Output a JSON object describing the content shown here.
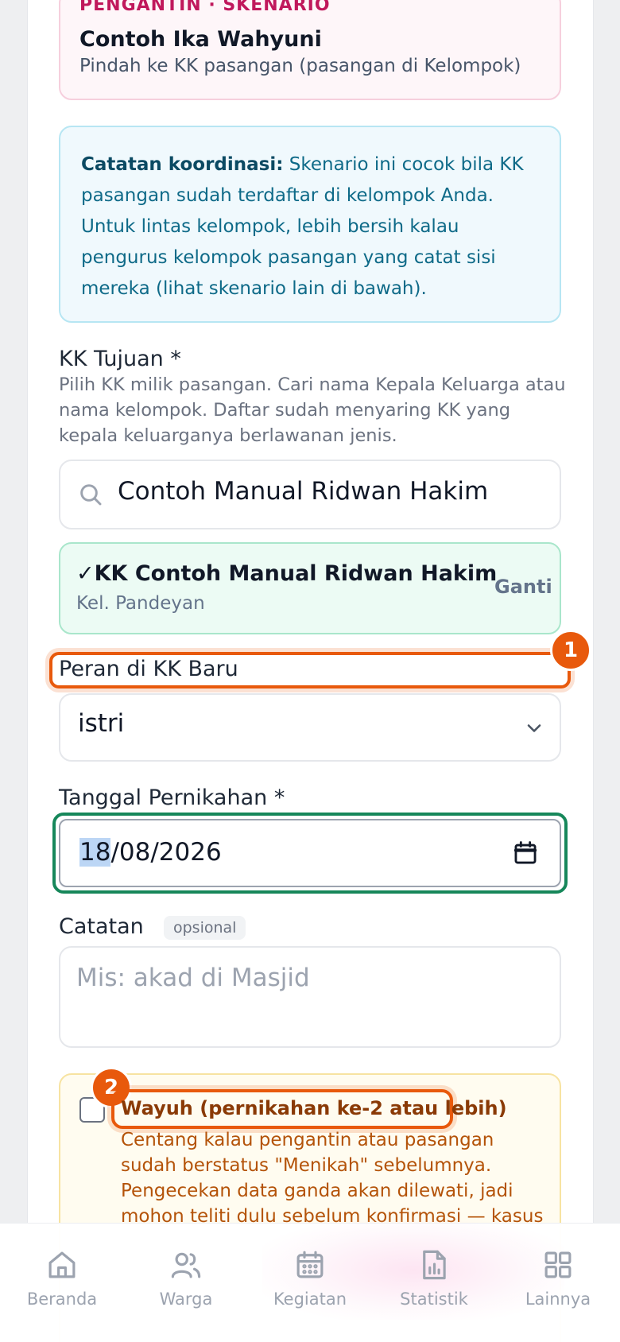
{
  "scenario": {
    "kicker": "PENGANTIN · SKENARIO",
    "title": "Contoh Ika Wahyuni",
    "subtitle": "Pindah ke KK pasangan (pasangan di Kelompok)"
  },
  "note": {
    "label": "Catatan koordinasi:",
    "text": "Skenario ini cocok bila KK pasangan sudah terdaftar di kelompok Anda. Untuk lintas kelompok, lebih bersih kalau pengurus kelompok pasangan yang catat sisi mereka (lihat skenario lain di bawah)."
  },
  "kk_tujuan": {
    "label": "KK Tujuan *",
    "help": "Pilih KK milik pasangan. Cari nama Kepala Keluarga atau nama kelompok. Daftar sudah menyaring KK yang kepala keluarganya berlawanan jenis.",
    "search_value": "Contoh Manual Ridwan Hakim",
    "selected_name": "✓KK Contoh Manual Ridwan Hakim",
    "selected_group": "Kel. Pandeyan",
    "change_label": "Ganti"
  },
  "peran": {
    "label": "Peran di KK Baru",
    "badge": "1",
    "selected": "istri"
  },
  "tanggal": {
    "label": "Tanggal Pernikahan *",
    "day": "18",
    "rest": "/08/2026"
  },
  "catatan": {
    "label": "Catatan",
    "optional": "opsional",
    "placeholder": "Mis: akad di Masjid"
  },
  "wayuh": {
    "badge": "2",
    "label": "Wayuh (pernikahan ke-2 atau lebih)",
    "description": "Centang kalau pengantin atau pasangan sudah berstatus \"Menikah\" sebelumnya. Pengecekan data ganda akan dilewati, jadi mohon teliti dulu sebelum konfirmasi — kasus",
    "checked": false
  },
  "nav": {
    "items": [
      {
        "label": "Beranda",
        "icon": "home-icon"
      },
      {
        "label": "Warga",
        "icon": "users-icon"
      },
      {
        "label": "Kegiatan",
        "icon": "calendar-icon"
      },
      {
        "label": "Statistik",
        "icon": "chart-icon"
      },
      {
        "label": "Lainnya",
        "icon": "grid-icon"
      }
    ]
  },
  "colors": {
    "accent_highlight": "#e8590c",
    "focus_green": "#16875a",
    "brand_pink": "#c0185c"
  }
}
